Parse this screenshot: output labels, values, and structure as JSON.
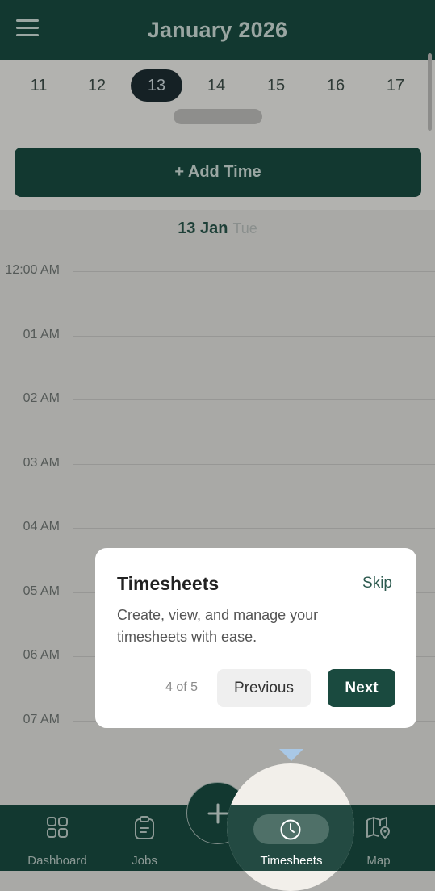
{
  "header": {
    "title": "January 2026"
  },
  "week": {
    "days": [
      "11",
      "12",
      "13",
      "14",
      "15",
      "16",
      "17"
    ],
    "selected": "13"
  },
  "actions": {
    "add_time_label": "+ Add Time"
  },
  "day_view": {
    "date": "13 Jan",
    "weekday": "Tue",
    "hours": [
      "12:00 AM",
      "01 AM",
      "02 AM",
      "03 AM",
      "04 AM",
      "05 AM",
      "06 AM",
      "07 AM"
    ]
  },
  "tour": {
    "title": "Timesheets",
    "skip_label": "Skip",
    "description": "Create, view, and manage your timesheets with ease.",
    "step": "4 of 5",
    "previous_label": "Previous",
    "next_label": "Next"
  },
  "bottom_nav": {
    "items": [
      {
        "label": "Dashboard",
        "icon": "grid-icon"
      },
      {
        "label": "Jobs",
        "icon": "clipboard-icon"
      },
      {
        "label": "Timesheets",
        "icon": "clock-icon",
        "active": true
      },
      {
        "label": "Map",
        "icon": "map-pin-icon"
      }
    ],
    "fab_icon": "plus-icon"
  },
  "colors": {
    "brand": "#123830",
    "overlay_dim": "#a9a9a6",
    "next_button": "#1a4a3f",
    "caret": "#a9c8e6"
  }
}
